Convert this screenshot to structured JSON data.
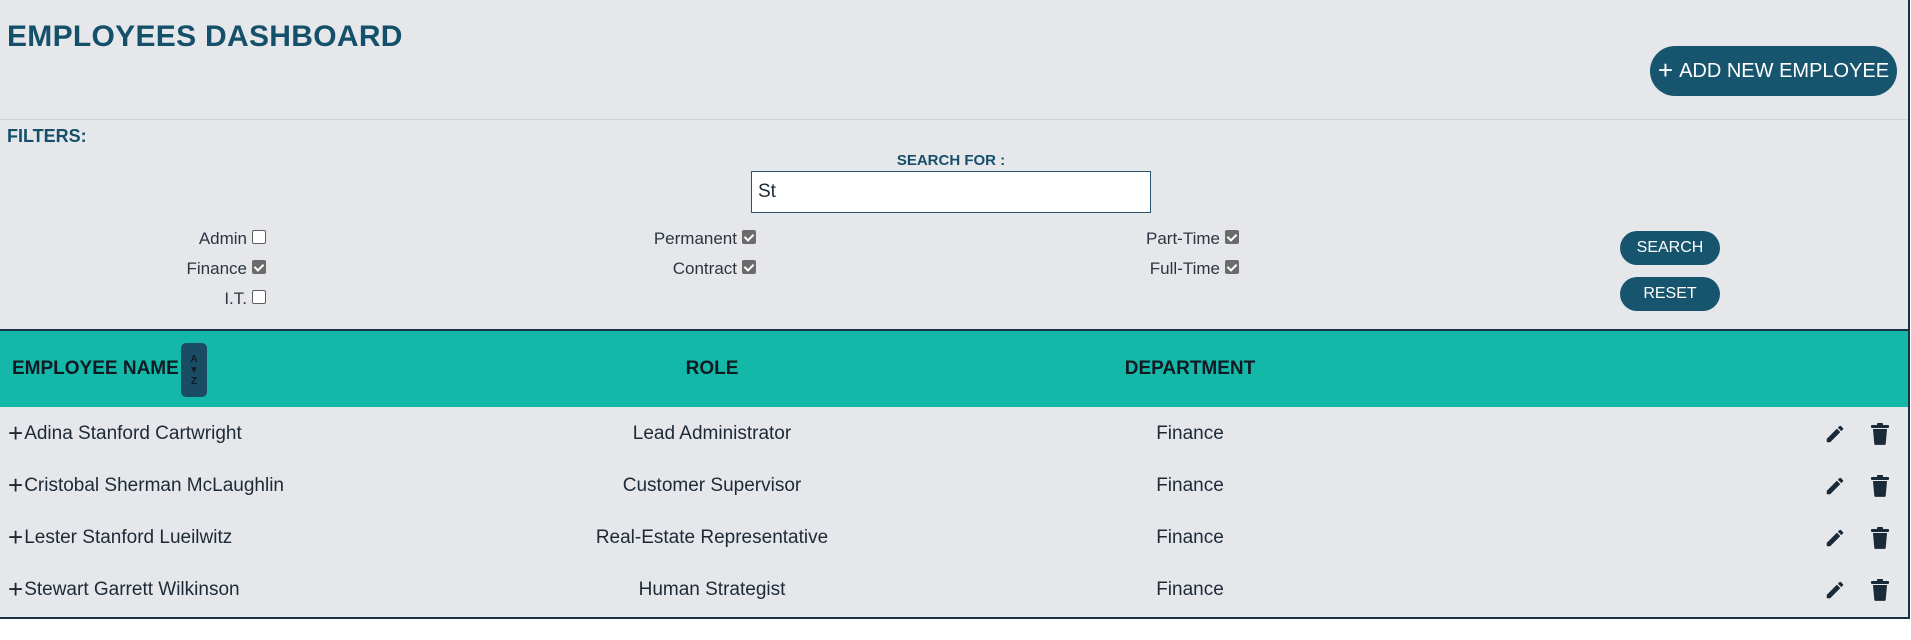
{
  "header": {
    "title": "EMPLOYEES DASHBOARD",
    "add_button_icon": "plus-icon",
    "add_button_label": "ADD NEW EMPLOYEE"
  },
  "filters": {
    "label": "FILTERS:",
    "search_label": "SEARCH FOR :",
    "search_value": "St",
    "departments": [
      {
        "label": "Admin",
        "checked": false
      },
      {
        "label": "Finance",
        "checked": true
      },
      {
        "label": "I.T.",
        "checked": false
      }
    ],
    "contract_types": [
      {
        "label": "Permanent",
        "checked": true
      },
      {
        "label": "Contract",
        "checked": true
      }
    ],
    "work_hours": [
      {
        "label": "Part-Time",
        "checked": true
      },
      {
        "label": "Full-Time",
        "checked": true
      }
    ],
    "search_button": "SEARCH",
    "reset_button": "RESET"
  },
  "table": {
    "columns": [
      "EMPLOYEE NAME",
      "ROLE",
      "DEPARTMENT"
    ],
    "sort_icon": {
      "top": "A",
      "arrow": "▼",
      "bottom": "Z"
    },
    "rows": [
      {
        "name": "Adina Stanford Cartwright",
        "role": "Lead Administrator",
        "department": "Finance"
      },
      {
        "name": "Cristobal Sherman McLaughlin",
        "role": "Customer Supervisor",
        "department": "Finance"
      },
      {
        "name": "Lester Stanford Lueilwitz",
        "role": "Real-Estate Representative",
        "department": "Finance"
      },
      {
        "name": "Stewart Garrett Wilkinson",
        "role": "Human Strategist",
        "department": "Finance"
      }
    ],
    "row_expand_icon": "plus-icon",
    "row_actions": [
      "pencil-icon",
      "trash-icon"
    ]
  },
  "colors": {
    "primary": "#17546e",
    "header_teal": "#13b8a8",
    "background": "#e6e7eb"
  }
}
